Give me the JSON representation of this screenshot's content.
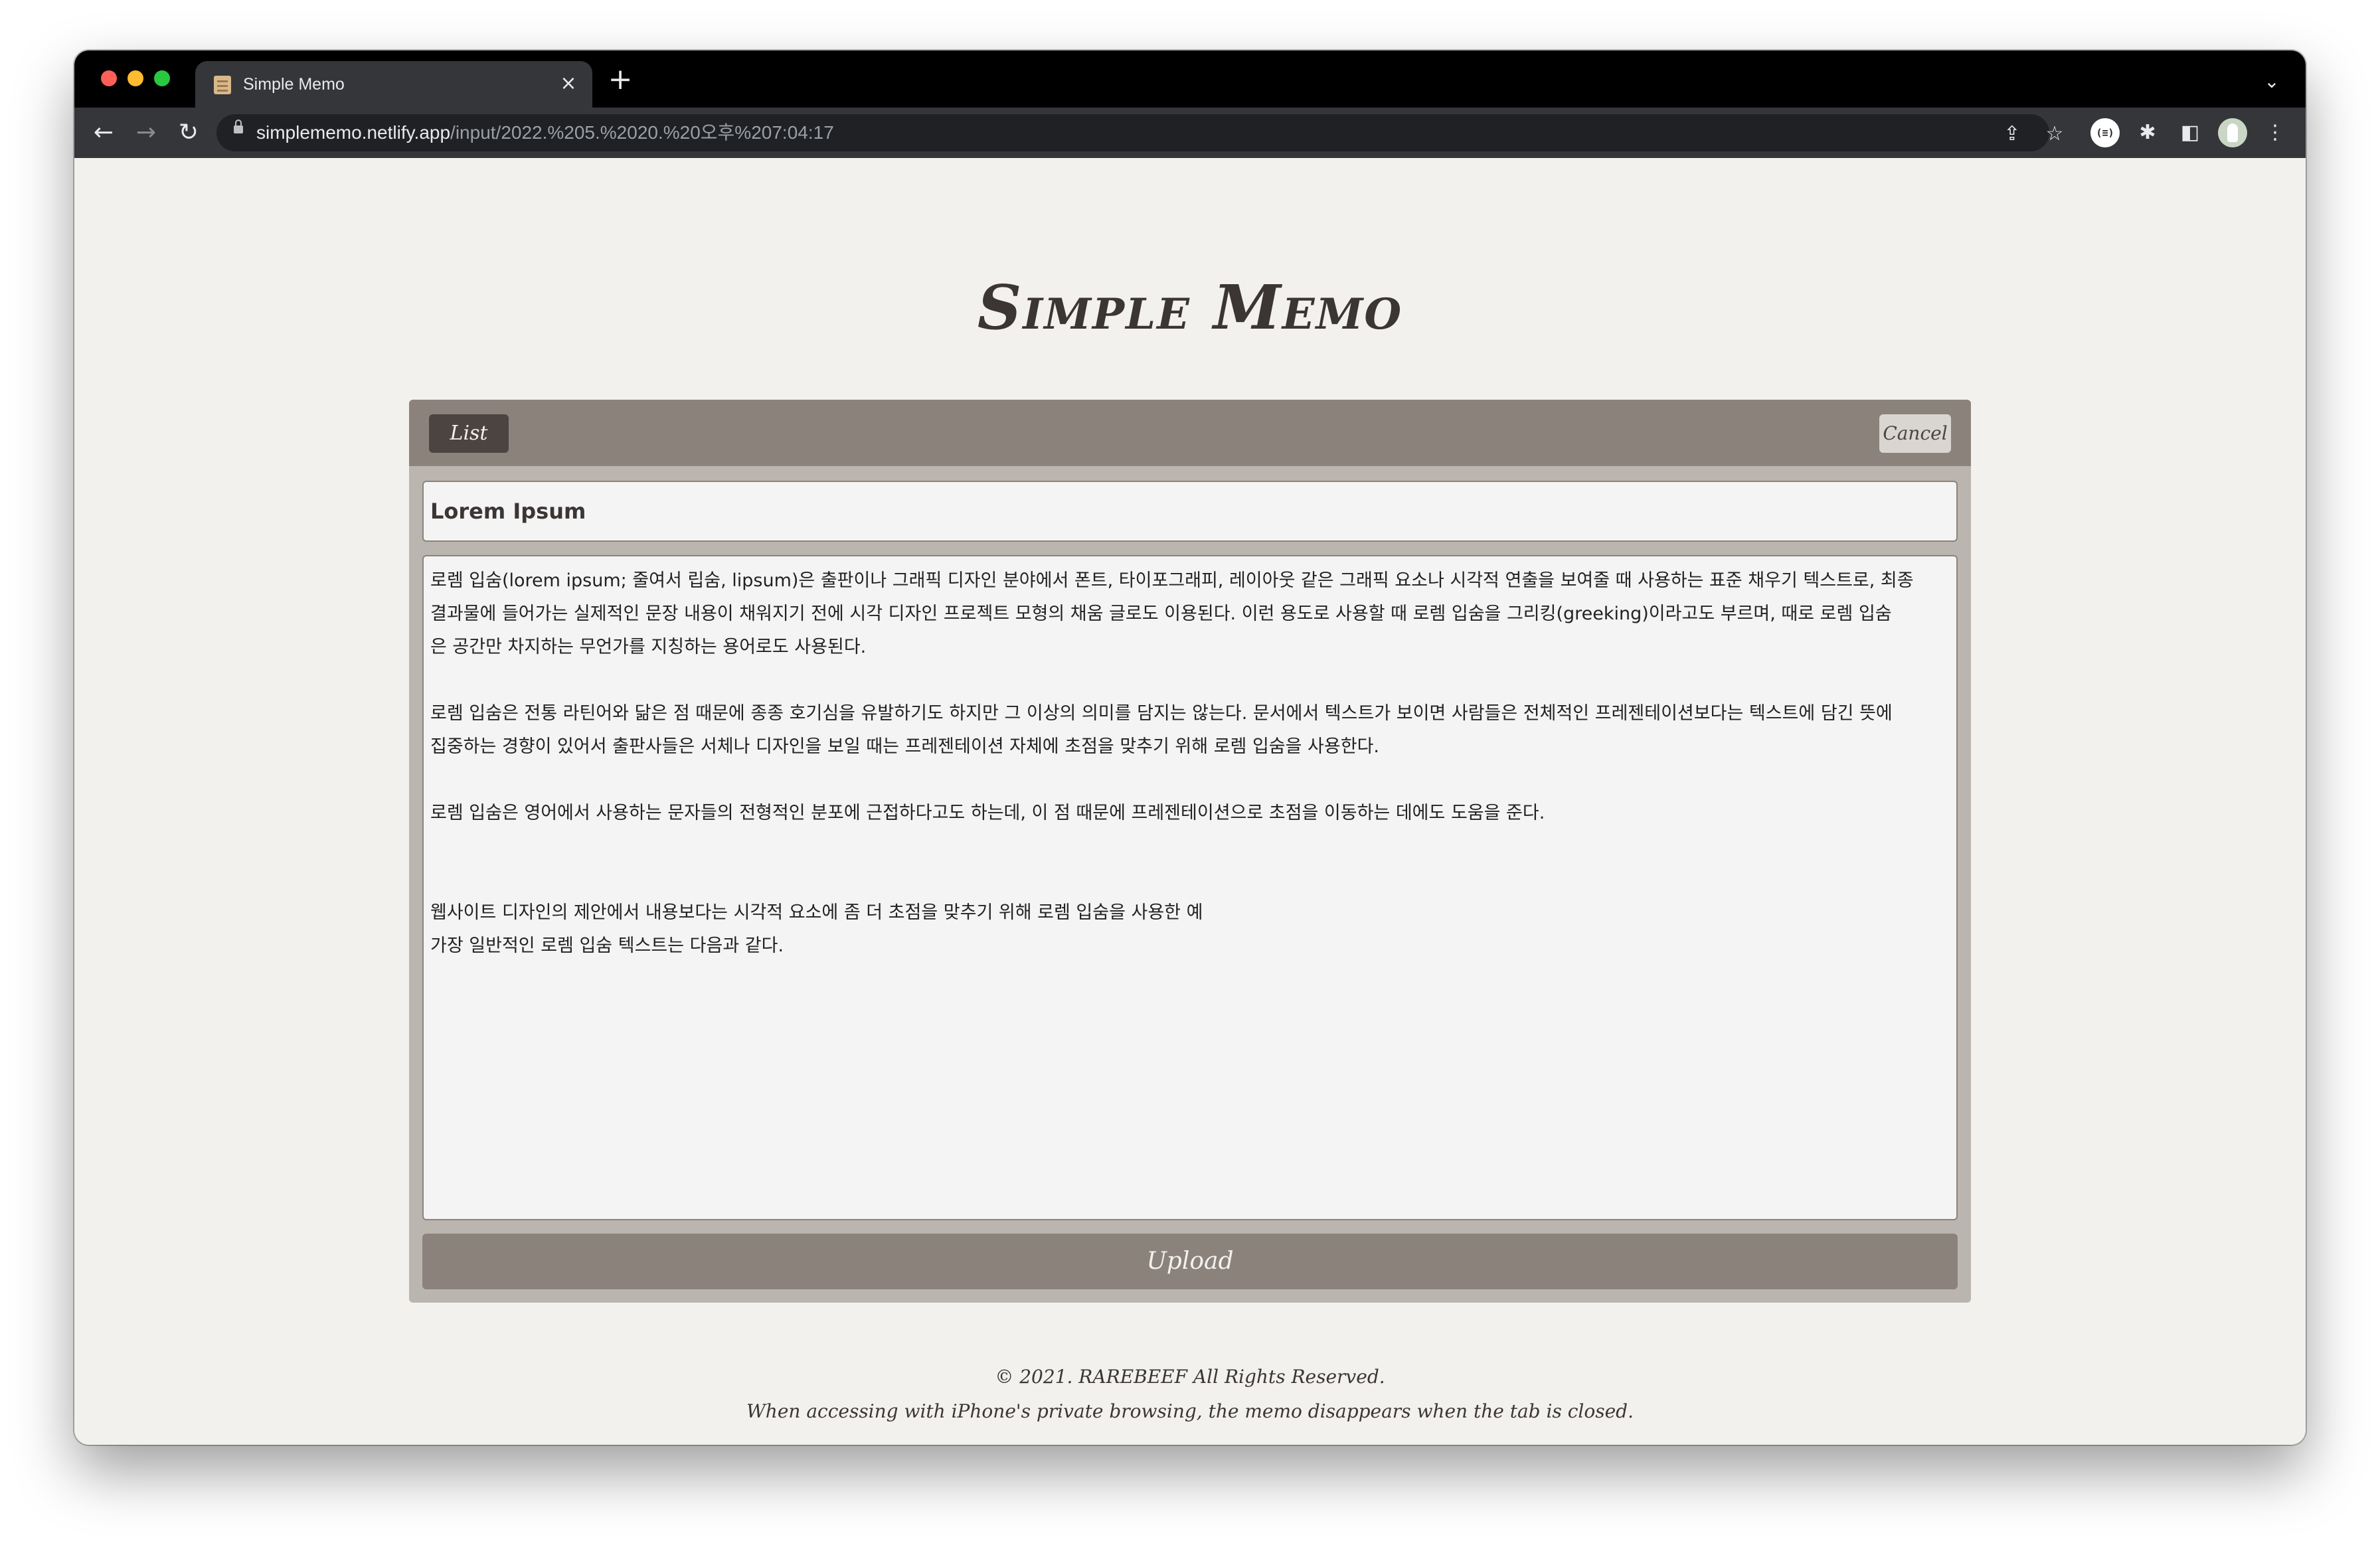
{
  "browser": {
    "tab_title": "Simple Memo",
    "url_host": "simplememo.netlify.app",
    "url_path": "/input/2022.%205.%2020.%20오후%207:04:17"
  },
  "app": {
    "title": "Simple Memo",
    "list_label": "List",
    "cancel_label": "Cancel",
    "upload_label": "Upload"
  },
  "memo": {
    "title": "Lorem Ipsum",
    "lines": [
      "로렘 입숨(lorem ipsum; 줄여서 립숨, lipsum)은 출판이나 그래픽 디자인 분야에서 폰트, 타이포그래피, 레이아웃 같은 그래픽 요소나 시각적 연출을 보여줄 때 사용하는 표준 채우기 텍스트로, 최종",
      "결과물에 들어가는 실제적인 문장 내용이 채워지기 전에 시각 디자인 프로젝트 모형의 채움 글로도 이용된다. 이런 용도로 사용할 때 로렘 입숨을 그리킹(greeking)이라고도 부르며, 때로 로렘 입숨",
      "은 공간만 차지하는 무언가를 지칭하는 용어로도 사용된다.",
      "",
      "로렘 입숨은 전통 라틴어와 닮은 점 때문에 종종 호기심을 유발하기도 하지만 그 이상의 의미를 담지는 않는다. 문서에서 텍스트가 보이면 사람들은 전체적인 프레젠테이션보다는 텍스트에 담긴 뜻에",
      "집중하는 경향이 있어서 출판사들은 서체나 디자인을 보일 때는 프레젠테이션 자체에 초점을 맞추기 위해 로렘 입숨을 사용한다.",
      "",
      "로렘 입숨은 영어에서 사용하는 문자들의 전형적인 분포에 근접하다고도 하는데, 이 점 때문에 프레젠테이션으로 초점을 이동하는 데에도 도움을 준다.",
      "",
      "",
      "웹사이트 디자인의 제안에서 내용보다는 시각적 요소에 좀 더 초점을 맞추기 위해 로렘 입숨을 사용한 예",
      "가장 일반적인 로렘 입숨 텍스트는 다음과 같다."
    ]
  },
  "footer": {
    "copyright": "© 2021. RAREBEEF All Rights Reserved.",
    "note": "When accessing with iPhone's private browsing, the memo disappears when the tab is closed."
  },
  "icons": {
    "back": "back-arrow-icon",
    "forward": "forward-arrow-icon",
    "reload": "reload-icon",
    "lock": "lock-icon",
    "share": "share-icon",
    "bookmark": "star-icon",
    "extension": "puzzle-icon",
    "side_panel": "side-panel-icon",
    "menu": "kebab-menu-icon"
  },
  "colors": {
    "page_background": "#f3f1ed",
    "card_header": "#8c827c",
    "card_body": "#bbb5af",
    "list_button": "#4b4441",
    "text_dark": "#3b3634"
  }
}
